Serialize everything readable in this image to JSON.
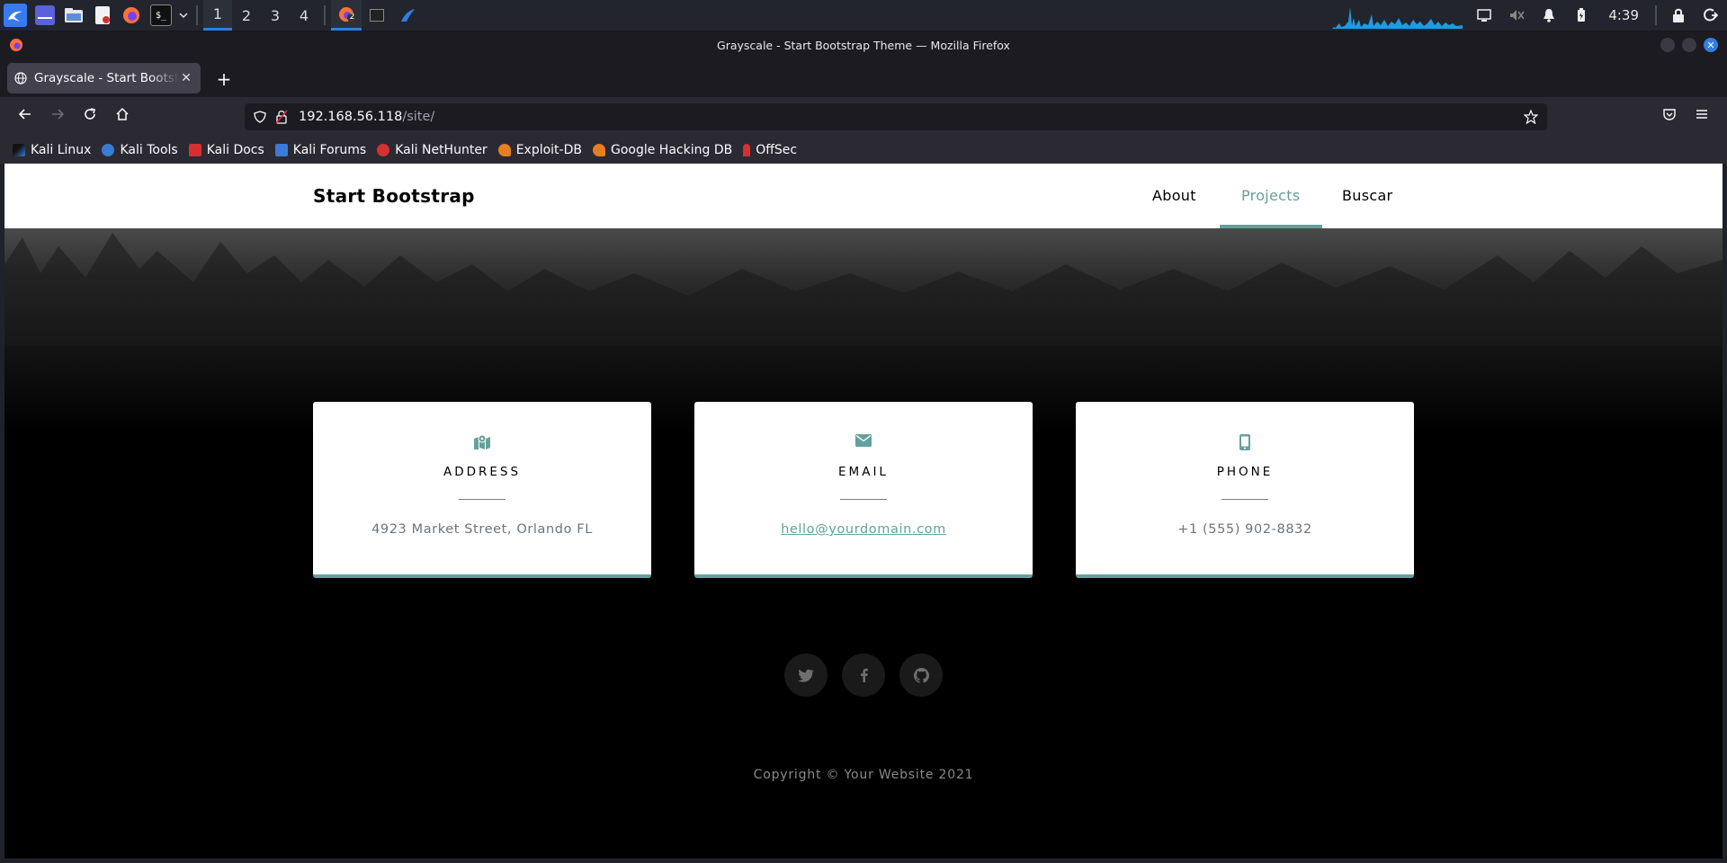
{
  "taskbar": {
    "workspaces": [
      "1",
      "2",
      "3",
      "4"
    ],
    "active_workspace": "1",
    "clock": "4:39",
    "firefox_badge": "2"
  },
  "window": {
    "title": "Grayscale - Start Bootstrap Theme — Mozilla Firefox"
  },
  "tab": {
    "title": "Grayscale - Start Bootstrap Theme"
  },
  "url": {
    "host": "192.168.56.118",
    "path": "/site/"
  },
  "bookmarks": [
    {
      "label": "Kali Linux",
      "icon": "kali-dragon-icon",
      "color": "#3a7bd5"
    },
    {
      "label": "Kali Tools",
      "icon": "kali-tools-icon",
      "color": "#3a7bd5"
    },
    {
      "label": "Kali Docs",
      "icon": "kali-docs-icon",
      "color": "#d63031"
    },
    {
      "label": "Kali Forums",
      "icon": "kali-forums-icon",
      "color": "#3a7bd5"
    },
    {
      "label": "Kali NetHunter",
      "icon": "nethunter-icon",
      "color": "#d63031"
    },
    {
      "label": "Exploit-DB",
      "icon": "exploit-db-icon",
      "color": "#e67e22"
    },
    {
      "label": "Google Hacking DB",
      "icon": "ghdb-icon",
      "color": "#e67e22"
    },
    {
      "label": "OffSec",
      "icon": "offsec-icon",
      "color": "#d63031"
    }
  ],
  "site": {
    "brand": "Start Bootstrap",
    "nav": [
      "About",
      "Projects",
      "Buscar"
    ],
    "active_nav": "Projects",
    "accent": "#64a19d",
    "cards": [
      {
        "title": "Address",
        "value": "4923 Market Street, Orlando FL",
        "icon": "map-icon"
      },
      {
        "title": "Email",
        "value": "hello@yourdomain.com",
        "icon": "envelope-icon"
      },
      {
        "title": "Phone",
        "value": "+1 (555) 902-8832",
        "icon": "mobile-phone-icon"
      }
    ],
    "social": [
      "twitter-icon",
      "facebook-icon",
      "github-icon"
    ],
    "copyright": "Copyright © Your Website 2021"
  }
}
